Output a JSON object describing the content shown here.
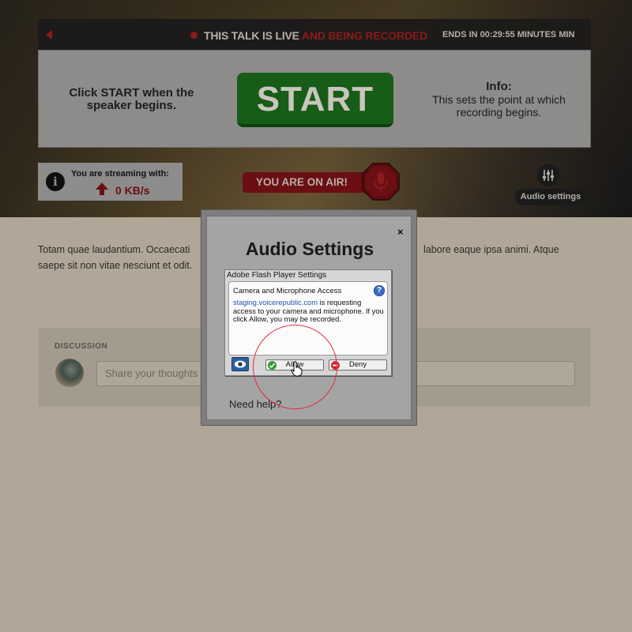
{
  "header": {
    "live_text": "THIS TALK IS LIVE",
    "recorded_text": "AND BEING RECORDED",
    "ends_in": "ENDS IN  00:29:55 MINUTES MIN"
  },
  "control": {
    "hint": "Click START when the speaker begins.",
    "start_label": "START",
    "info_title": "Info:",
    "info_text": "This sets the point at which recording begins."
  },
  "stream": {
    "label": "You are streaming with:",
    "rate": "0 KB/s"
  },
  "on_air": "YOU ARE ON AIR!",
  "audio_settings_label": "Audio settings",
  "description": "Totam quae laudantium. Occaecati … labore eaque ipsa animi. Atque saepe sit non vitae nesciunt et odit.",
  "description_left": "Totam quae laudantium. Occaecati",
  "description_right": "labore eaque ipsa animi. Atque",
  "description_line2": "saepe sit non vitae nesciunt et odit.",
  "discussion": {
    "title": "DISCUSSION",
    "placeholder": "Share your thoughts"
  },
  "modal": {
    "title": "Audio Settings",
    "close": "×",
    "help": "Need help?"
  },
  "flash": {
    "header": "Adobe Flash Player Settings",
    "panel_title": "Camera and Microphone Access",
    "link": "staging.voicerepublic.com",
    "message": " is requesting access to your camera and microphone. If you click Allow, you may be recorded.",
    "allow": "Allow",
    "deny": "Deny",
    "help_glyph": "?"
  },
  "colors": {
    "brand_red": "#8b1a1a",
    "start_green": "#175c17",
    "ring_red": "#e6283f"
  }
}
